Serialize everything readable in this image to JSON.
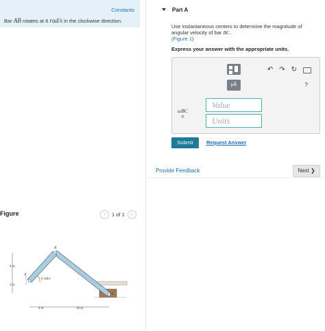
{
  "problem": {
    "constants_label": "Constants",
    "statement_prefix": "Bar ",
    "statement_bar": "AB",
    "statement_mid": " rotates at 6 ",
    "statement_unit": "rad/s",
    "statement_suffix": " in the clockwise direction."
  },
  "figure": {
    "title": "Figure",
    "pager": "1 of 1",
    "labels": {
      "A": "A",
      "B": "B",
      "C": "C",
      "rate": "6 rad/s",
      "dim_4in_left": "4 in",
      "dim_3in": "3 in",
      "dim_4in_bottom": "4 in",
      "dim_10in": "10 in"
    }
  },
  "part": {
    "title": "Part A",
    "instruction_1": "Use instantaneous centers to determine the magnitude of angular velocity of bar ",
    "instruction_bar": "BC",
    "instruction_end": ".",
    "figure_link": "(Figure 1)",
    "express": "Express your answer with the appropriate units.",
    "answer_symbol": "ωBC",
    "answer_eq": "=",
    "value_placeholder": "Value",
    "units_placeholder": "Units",
    "tool_units_label": "μÅ",
    "help": "?"
  },
  "actions": {
    "submit": "Submit",
    "request_answer": "Request Answer",
    "feedback": "Provide Feedback",
    "next": "Next ❯"
  },
  "colors": {
    "accent": "#1f7a99",
    "link": "#1e6fb5",
    "problem_bg": "#e5f1f8",
    "bar_fill": "#a9cde0"
  }
}
